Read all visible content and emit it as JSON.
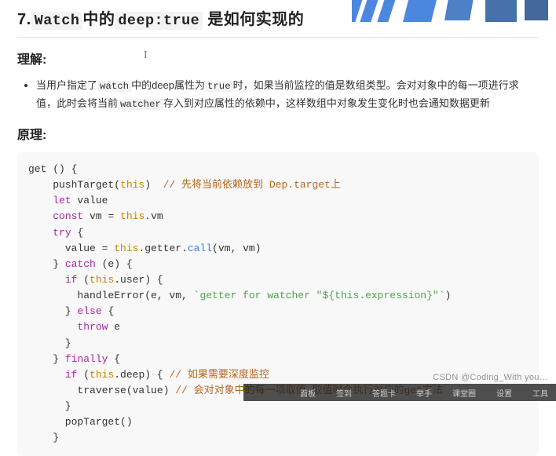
{
  "title_prefix": "7.",
  "title_code1": "Watch",
  "title_mid": "中的",
  "title_code2": "deep:true",
  "title_suffix": "是如何实现的",
  "section_understand": "理解:",
  "bullet_before_code1": "当用户指定了",
  "bullet_code1": "watch",
  "bullet_mid1": "中的deep属性为",
  "bullet_code2": "true",
  "bullet_mid2": "时，如果当前监控的值是数组类型。会对对象中的每一项进行求值，此时会将当前",
  "bullet_code3": "watcher",
  "bullet_after": "存入到对应属性的依赖中，这样数组中对象发生变化时也会通知数据更新",
  "section_principle": "原理:",
  "code": {
    "l1": "get () {",
    "l2a": "    pushTarget(",
    "l2b": "this",
    "l2c": ")  ",
    "l2cmt": "// 先将当前依赖放到 Dep.target上",
    "l3a": "    ",
    "l3kw": "let",
    "l3b": " value",
    "l4a": "    ",
    "l4kw": "const",
    "l4b": " vm = ",
    "l4this": "this",
    "l4c": ".vm",
    "l5a": "    ",
    "l5kw": "try",
    "l5b": " {",
    "l6a": "      value = ",
    "l6this": "this",
    "l6b": ".getter.",
    "l6fn": "call",
    "l6c": "(vm, vm)",
    "l7a": "    } ",
    "l7kw": "catch",
    "l7b": " (e) {",
    "l8a": "      ",
    "l8kw": "if",
    "l8b": " (",
    "l8this": "this",
    "l8c": ".user) {",
    "l9": "        handleError(e, vm, ",
    "l9str": "`getter for watcher \"${this.expression}\"`",
    "l9c": ")",
    "l10a": "      } ",
    "l10kw": "else",
    "l10b": " {",
    "l11a": "        ",
    "l11kw": "throw",
    "l11b": " e",
    "l12": "      }",
    "l13a": "    } ",
    "l13kw": "finally",
    "l13b": " {",
    "l14a": "      ",
    "l14kw": "if",
    "l14b": " (",
    "l14this": "this",
    "l14c": ".deep) { ",
    "l14cmt": "// 如果需要深度监控",
    "l15a": "        traverse(value) ",
    "l15cmt": "// 会对对象中的每一项取值,取值时会执行对应的get方法",
    "l16": "      }",
    "l17": "      popTarget()",
    "l18": "    }"
  },
  "footer": {
    "i1": "面板",
    "i2": "签到",
    "i3": "答题卡",
    "i4": "举手",
    "i5": "课堂圈",
    "i6": "设置",
    "i7": "工具"
  },
  "csdn": "CSDN @Coding_With you…"
}
